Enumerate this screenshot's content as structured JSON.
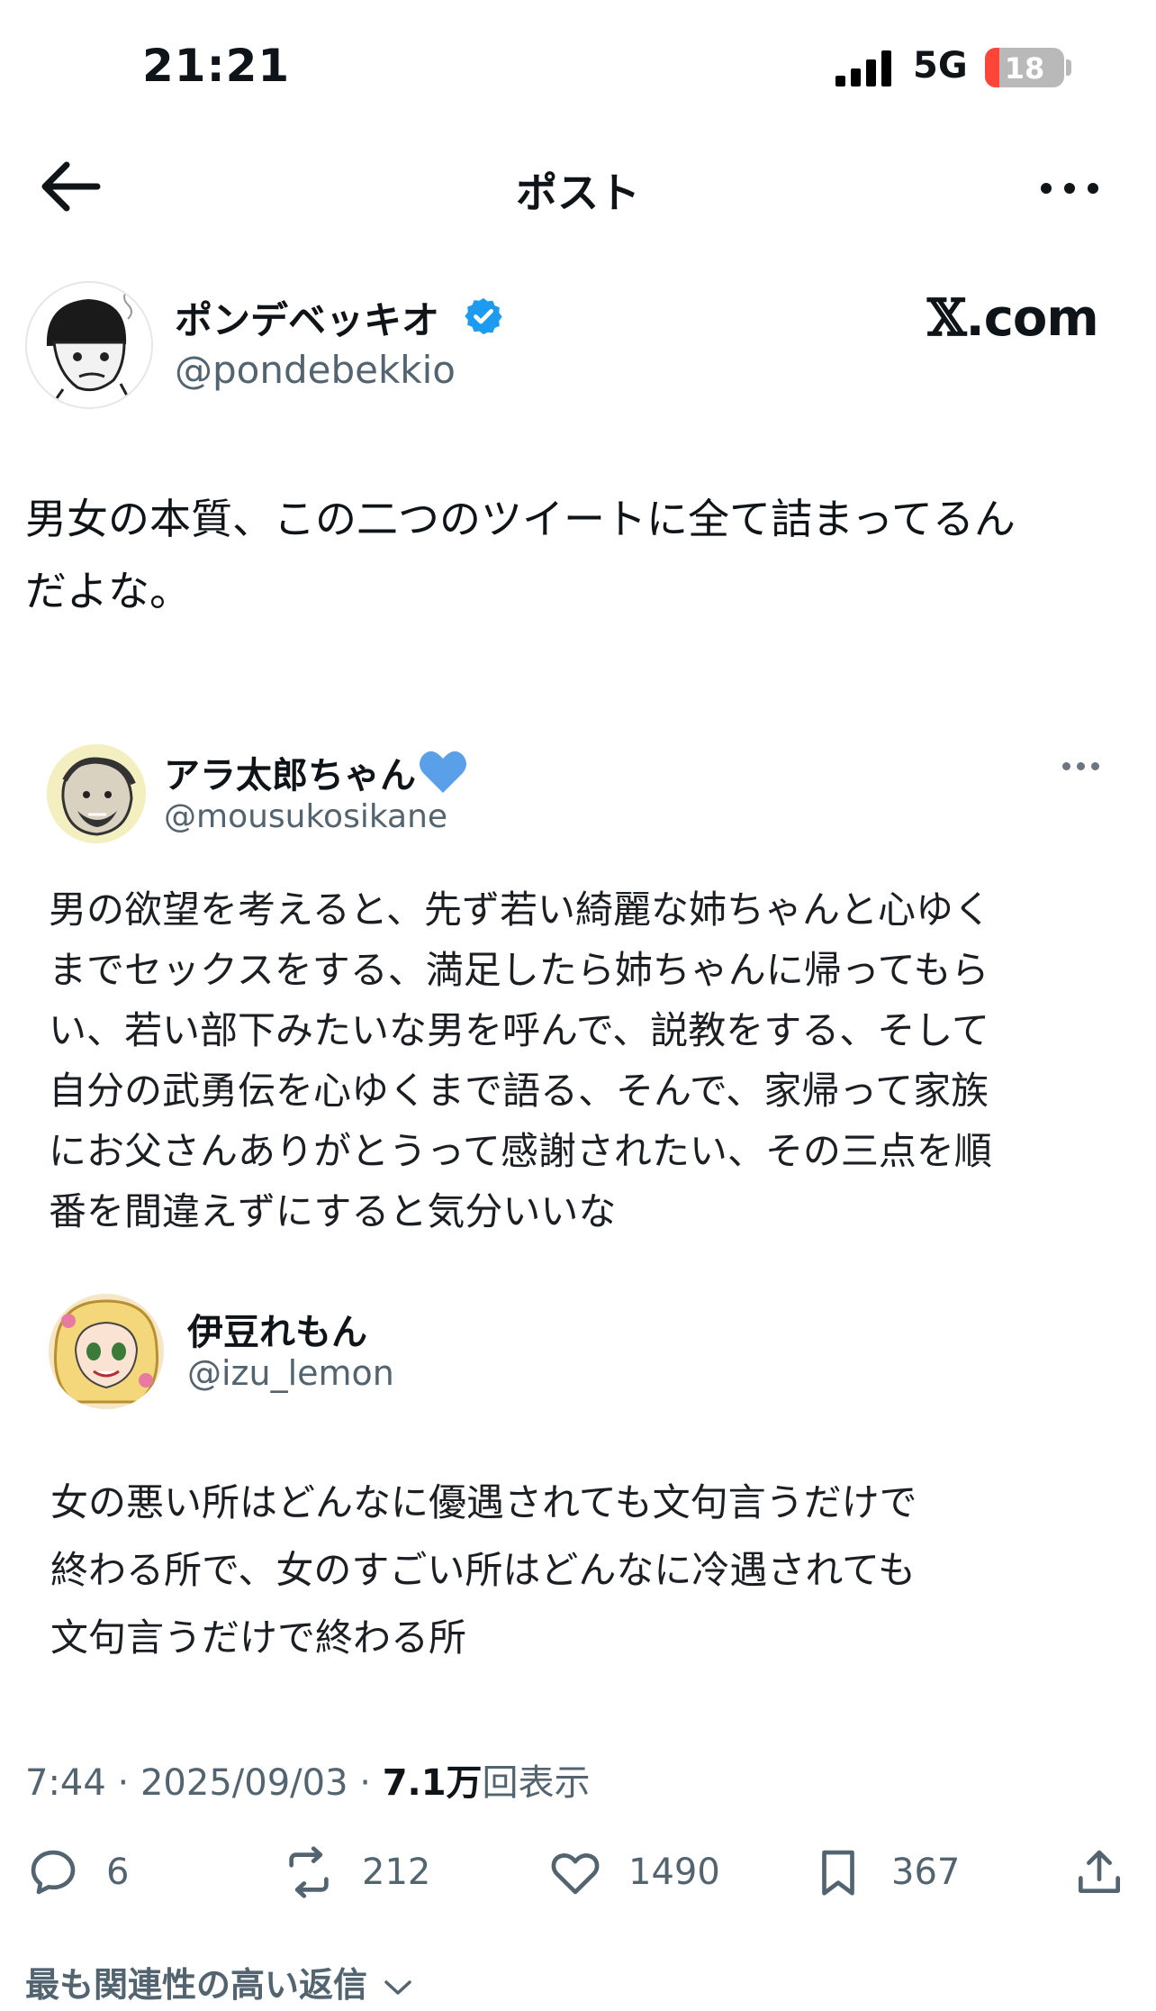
{
  "status_bar": {
    "time": "21:21",
    "network": "5G",
    "battery": "18",
    "battery_level": 0.18
  },
  "nav": {
    "title": "ポスト",
    "back_icon": "arrow-left-icon",
    "more_icon": "more-horizontal-icon"
  },
  "author": {
    "name": "ポンデベッキオ",
    "handle": "@pondebekkio",
    "verified": true
  },
  "watermark": {
    "x": "𝕏",
    "suffix": ".com"
  },
  "tweet": {
    "text_line1": "男女の本質、この二つのツイートに全て詰まってるん",
    "text_line2": "だよな。"
  },
  "quote1": {
    "name": "アラ太郎ちゃん",
    "handle": "@mousukosikane",
    "lines": [
      "男の欲望を考えると、先ず若い綺麗な姉ちゃんと心ゆく",
      "までセックスをする、満足したら姉ちゃんに帰ってもら",
      "い、若い部下みたいな男を呼んで、説教をする、そして",
      "自分の武勇伝を心ゆくまで語る、そんで、家帰って家族",
      "にお父さんありがとうって感謝されたい、その三点を順",
      "番を間違えずにすると気分いいな"
    ],
    "heart_color": "#5aa0e8"
  },
  "quote2": {
    "name": "伊豆れもん",
    "handle": "@izu_lemon",
    "lines": [
      "女の悪い所はどんなに優遇されても文句言うだけで",
      "終わる所で、女のすごい所はどんなに冷遇されても",
      "文句言うだけで終わる所"
    ]
  },
  "meta": {
    "time": "7:44",
    "sep1": " · ",
    "date": "2025/09/03",
    "sep2": " · ",
    "views": "7.1万",
    "views_label": "回表示"
  },
  "actions": {
    "replies": "6",
    "retweets": "212",
    "likes": "1490",
    "bookmarks": "367"
  },
  "relevant_replies": "最も関連性の高い返信",
  "colors": {
    "verified": "#1d9bf0",
    "text": "#0f1419",
    "secondary": "#536471"
  }
}
